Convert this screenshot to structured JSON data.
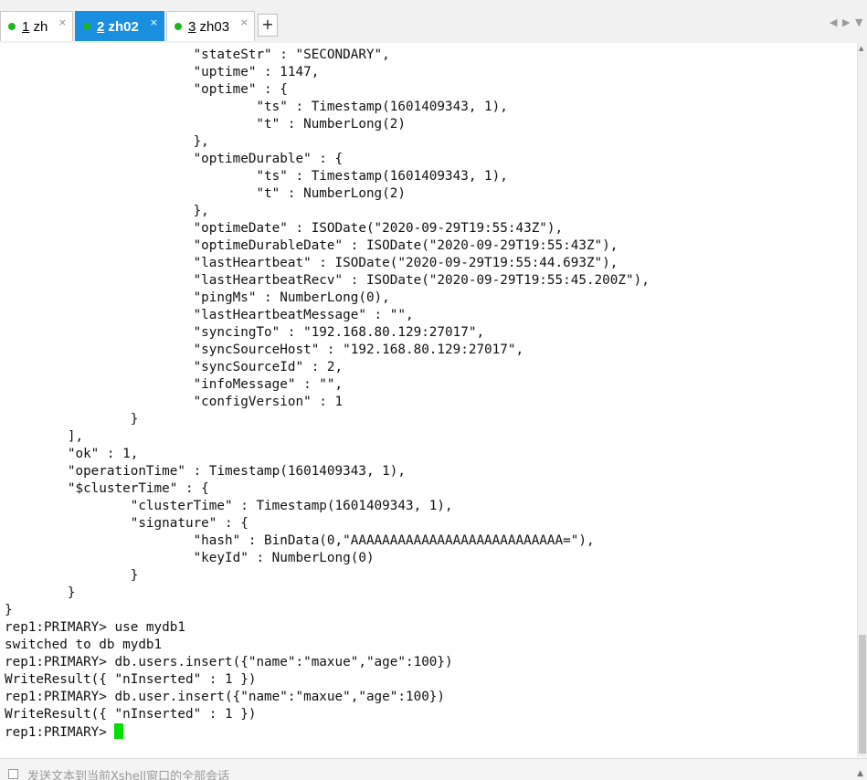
{
  "tabs": [
    {
      "number": "1",
      "name": "zh",
      "close": "×",
      "active": false
    },
    {
      "number": "2",
      "name": "zh02",
      "close": "×",
      "active": true
    },
    {
      "number": "3",
      "name": "zh03",
      "close": "×",
      "active": false
    }
  ],
  "tab_add_label": "+",
  "tab_nav": {
    "prev": "◀",
    "next": "▶",
    "menu": "▼"
  },
  "terminal": {
    "lines": [
      "\t\t\t\"stateStr\" : \"SECONDARY\",",
      "\t\t\t\"uptime\" : 1147,",
      "\t\t\t\"optime\" : {",
      "\t\t\t\t\"ts\" : Timestamp(1601409343, 1),",
      "\t\t\t\t\"t\" : NumberLong(2)",
      "\t\t\t},",
      "\t\t\t\"optimeDurable\" : {",
      "\t\t\t\t\"ts\" : Timestamp(1601409343, 1),",
      "\t\t\t\t\"t\" : NumberLong(2)",
      "\t\t\t},",
      "\t\t\t\"optimeDate\" : ISODate(\"2020-09-29T19:55:43Z\"),",
      "\t\t\t\"optimeDurableDate\" : ISODate(\"2020-09-29T19:55:43Z\"),",
      "\t\t\t\"lastHeartbeat\" : ISODate(\"2020-09-29T19:55:44.693Z\"),",
      "\t\t\t\"lastHeartbeatRecv\" : ISODate(\"2020-09-29T19:55:45.200Z\"),",
      "\t\t\t\"pingMs\" : NumberLong(0),",
      "\t\t\t\"lastHeartbeatMessage\" : \"\",",
      "\t\t\t\"syncingTo\" : \"192.168.80.129:27017\",",
      "\t\t\t\"syncSourceHost\" : \"192.168.80.129:27017\",",
      "\t\t\t\"syncSourceId\" : 2,",
      "\t\t\t\"infoMessage\" : \"\",",
      "\t\t\t\"configVersion\" : 1",
      "\t\t}",
      "\t],",
      "\t\"ok\" : 1,",
      "\t\"operationTime\" : Timestamp(1601409343, 1),",
      "\t\"$clusterTime\" : {",
      "\t\t\"clusterTime\" : Timestamp(1601409343, 1),",
      "\t\t\"signature\" : {",
      "\t\t\t\"hash\" : BinData(0,\"AAAAAAAAAAAAAAAAAAAAAAAAAAA=\"),",
      "\t\t\t\"keyId\" : NumberLong(0)",
      "\t\t}",
      "\t}",
      "}",
      "rep1:PRIMARY> use mydb1",
      "switched to db mydb1",
      "rep1:PRIMARY> db.users.insert({\"name\":\"maxue\",\"age\":100})",
      "WriteResult({ \"nInserted\" : 1 })",
      "rep1:PRIMARY> db.user.insert({\"name\":\"maxue\",\"age\":100})",
      "WriteResult({ \"nInserted\" : 1 })"
    ],
    "prompt": "rep1:PRIMARY>"
  },
  "compose": {
    "placeholder": "发送文本到当前Xshell窗口的全部会话"
  },
  "colors": {
    "active_tab": "#1a8fe0",
    "status_dot": "#1eb61e",
    "cursor": "#00e000"
  }
}
